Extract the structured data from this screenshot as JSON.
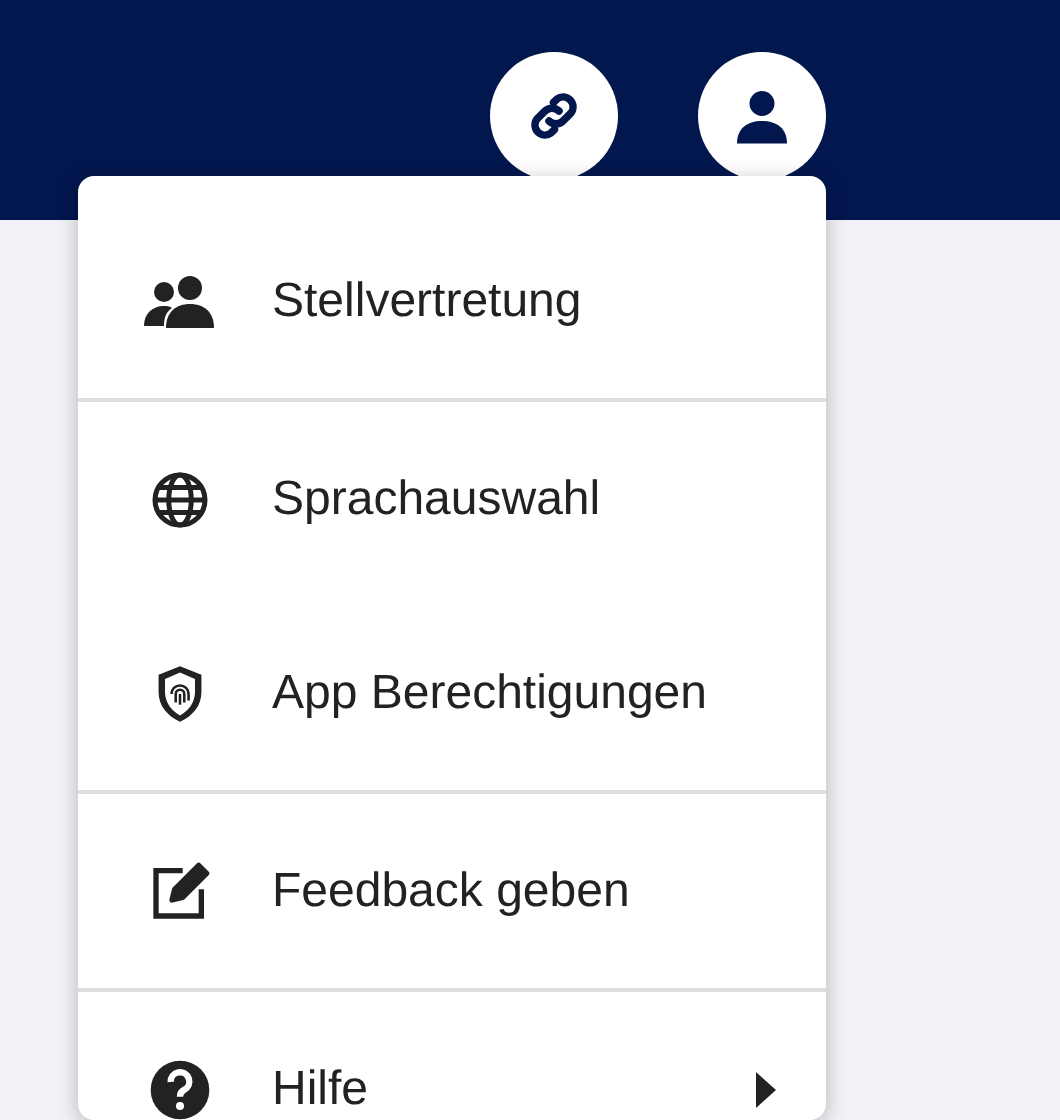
{
  "header": {
    "buttons": [
      {
        "kind": "link"
      },
      {
        "kind": "user"
      }
    ]
  },
  "menu": {
    "sections": [
      [
        {
          "label": "Stellvertretung",
          "kind": "people",
          "has_submenu": false
        }
      ],
      [
        {
          "label": "Sprachauswahl",
          "kind": "globe",
          "has_submenu": false
        },
        {
          "label": "App Berechtigungen",
          "kind": "shield",
          "has_submenu": false
        }
      ],
      [
        {
          "label": "Feedback geben",
          "kind": "edit",
          "has_submenu": false
        }
      ],
      [
        {
          "label": "Hilfe",
          "kind": "help",
          "has_submenu": true
        }
      ]
    ]
  }
}
